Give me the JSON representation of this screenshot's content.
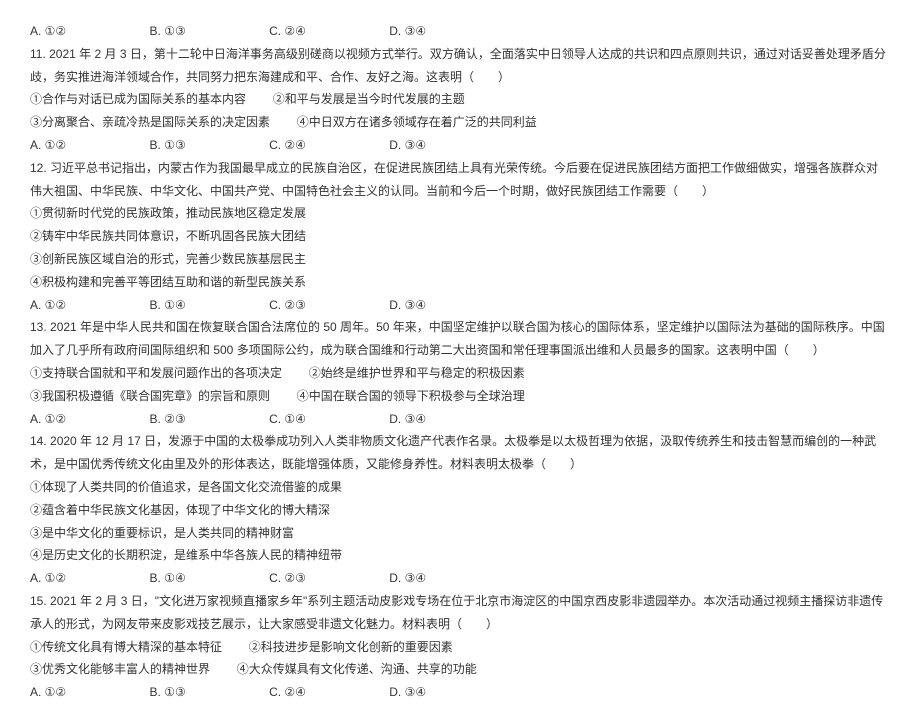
{
  "q10_options": {
    "a": "A. ①②",
    "b": "B. ①③",
    "c": "C. ②④",
    "d": "D. ③④"
  },
  "q11": {
    "text": "11. 2021 年 2 月 3 日，第十二轮中日海洋事务高级别磋商以视频方式举行。双方确认，全面落实中日领导人达成的共识和四点原则共识，通过对话妥善处理矛盾分歧，务实推进海洋领域合作，共同努力把东海建成和平、合作、友好之海。这表明（　　）",
    "s1": "①合作与对话已成为国际关系的基本内容",
    "s2": "②和平与发展是当今时代发展的主题",
    "s3": "③分离聚合、亲疏冷热是国际关系的决定因素",
    "s4": "④中日双方在诸多领域存在着广泛的共同利益",
    "a": "A. ①②",
    "b": "B. ①③",
    "c": "C. ②④",
    "d": "D. ③④"
  },
  "q12": {
    "text": "12. 习近平总书记指出，内蒙古作为我国最早成立的民族自治区，在促进民族团结上具有光荣传统。今后要在促进民族团结方面把工作做细做实，增强各族群众对伟大祖国、中华民族、中华文化、中国共产党、中国特色社会主义的认同。当前和今后一个时期，做好民族团结工作需要（　　）",
    "s1": "①贯彻新时代党的民族政策，推动民族地区稳定发展",
    "s2": "②铸牢中华民族共同体意识，不断巩固各民族大团结",
    "s3": "③创新民族区域自治的形式，完善少数民族基层民主",
    "s4": "④积极构建和完善平等团结互助和谐的新型民族关系",
    "a": "A. ①②",
    "b": "B. ①④",
    "c": "C. ②③",
    "d": "D. ③④"
  },
  "q13": {
    "text": "13. 2021 年是中华人民共和国在恢复联合国合法席位的 50 周年。50 年来，中国坚定维护以联合国为核心的国际体系，坚定维护以国际法为基础的国际秩序。中国加入了几乎所有政府间国际组织和 500 多项国际公约，成为联合国维和行动第二大出资国和常任理事国派出维和人员最多的国家。这表明中国（　　）",
    "s1": "①支持联合国就和平和发展问题作出的各项决定",
    "s2": "②始终是维护世界和平与稳定的积极因素",
    "s3": "③我国积极遵循《联合国宪章》的宗旨和原则",
    "s4": "④中国在联合国的领导下积极参与全球治理",
    "a": "A. ①②",
    "b": "B. ②③",
    "c": "C. ①④",
    "d": "D. ③④"
  },
  "q14": {
    "text": "14. 2020 年 12 月 17 日，发源于中国的太极拳成功列入人类非物质文化遗产代表作名录。太极拳是以太极哲理为依据，汲取传统养生和技击智慧而编创的一种武术，是中国优秀传统文化由里及外的形体表达，既能增强体质，又能修身养性。材料表明太极拳（　　）",
    "s1": "①体现了人类共同的价值追求，是各国文化交流借鉴的成果",
    "s2": "②蕴含着中华民族文化基因，体现了中华文化的博大精深",
    "s3": "③是中华文化的重要标识，是人类共同的精神财富",
    "s4": "④是历史文化的长期积淀，是维系中华各族人民的精神纽带",
    "a": "A. ①②",
    "b": "B. ①④",
    "c": "C. ②③",
    "d": "D. ③④"
  },
  "q15": {
    "text": "15. 2021 年 2 月 3 日，\"文化进万家视频直播家乡年\"系列主题活动皮影戏专场在位于北京市海淀区的中国京西皮影非遗园举办。本次活动通过视频主播探访非遗传承人的形式，为网友带来皮影戏技艺展示，让大家感受非遗文化魅力。材料表明（　　）",
    "s1": "①传统文化具有博大精深的基本特征",
    "s2": "②科技进步是影响文化创新的重要因素",
    "s3": "③优秀文化能够丰富人的精神世界",
    "s4": "④大众传媒具有文化传递、沟通、共享的功能",
    "a": "A. ①②",
    "b": "B. ①③",
    "c": "C. ②④",
    "d": "D. ③④"
  }
}
